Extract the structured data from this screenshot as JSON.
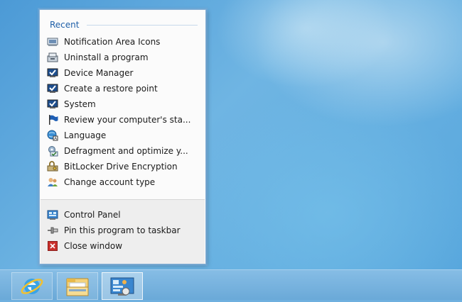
{
  "jumplist": {
    "recent_header": "Recent",
    "recent_items": [
      {
        "label": "Notification Area Icons",
        "icon": "notification-area-icon"
      },
      {
        "label": "Uninstall a program",
        "icon": "programs-icon"
      },
      {
        "label": "Device Manager",
        "icon": "device-manager-icon"
      },
      {
        "label": "Create a restore point",
        "icon": "system-icon"
      },
      {
        "label": "System",
        "icon": "system-icon"
      },
      {
        "label": "Review your computer's sta...",
        "icon": "action-center-flag-icon"
      },
      {
        "label": "Language",
        "icon": "language-icon"
      },
      {
        "label": "Defragment and optimize y...",
        "icon": "defrag-icon"
      },
      {
        "label": "BitLocker Drive Encryption",
        "icon": "bitlocker-icon"
      },
      {
        "label": "Change account type",
        "icon": "user-accounts-icon"
      }
    ],
    "tasks": [
      {
        "label": "Control Panel",
        "icon": "control-panel-icon"
      },
      {
        "label": "Pin this program to taskbar",
        "icon": "pin-icon"
      },
      {
        "label": "Close window",
        "icon": "close-window-icon"
      }
    ]
  },
  "taskbar": {
    "buttons": [
      {
        "icon": "internet-explorer-icon"
      },
      {
        "icon": "file-explorer-icon"
      },
      {
        "icon": "control-panel-icon",
        "active": true
      }
    ]
  },
  "colors": {
    "header_text": "#1e5fa8",
    "taskbar": "#78b4e0",
    "close_red": "#c9302c"
  }
}
